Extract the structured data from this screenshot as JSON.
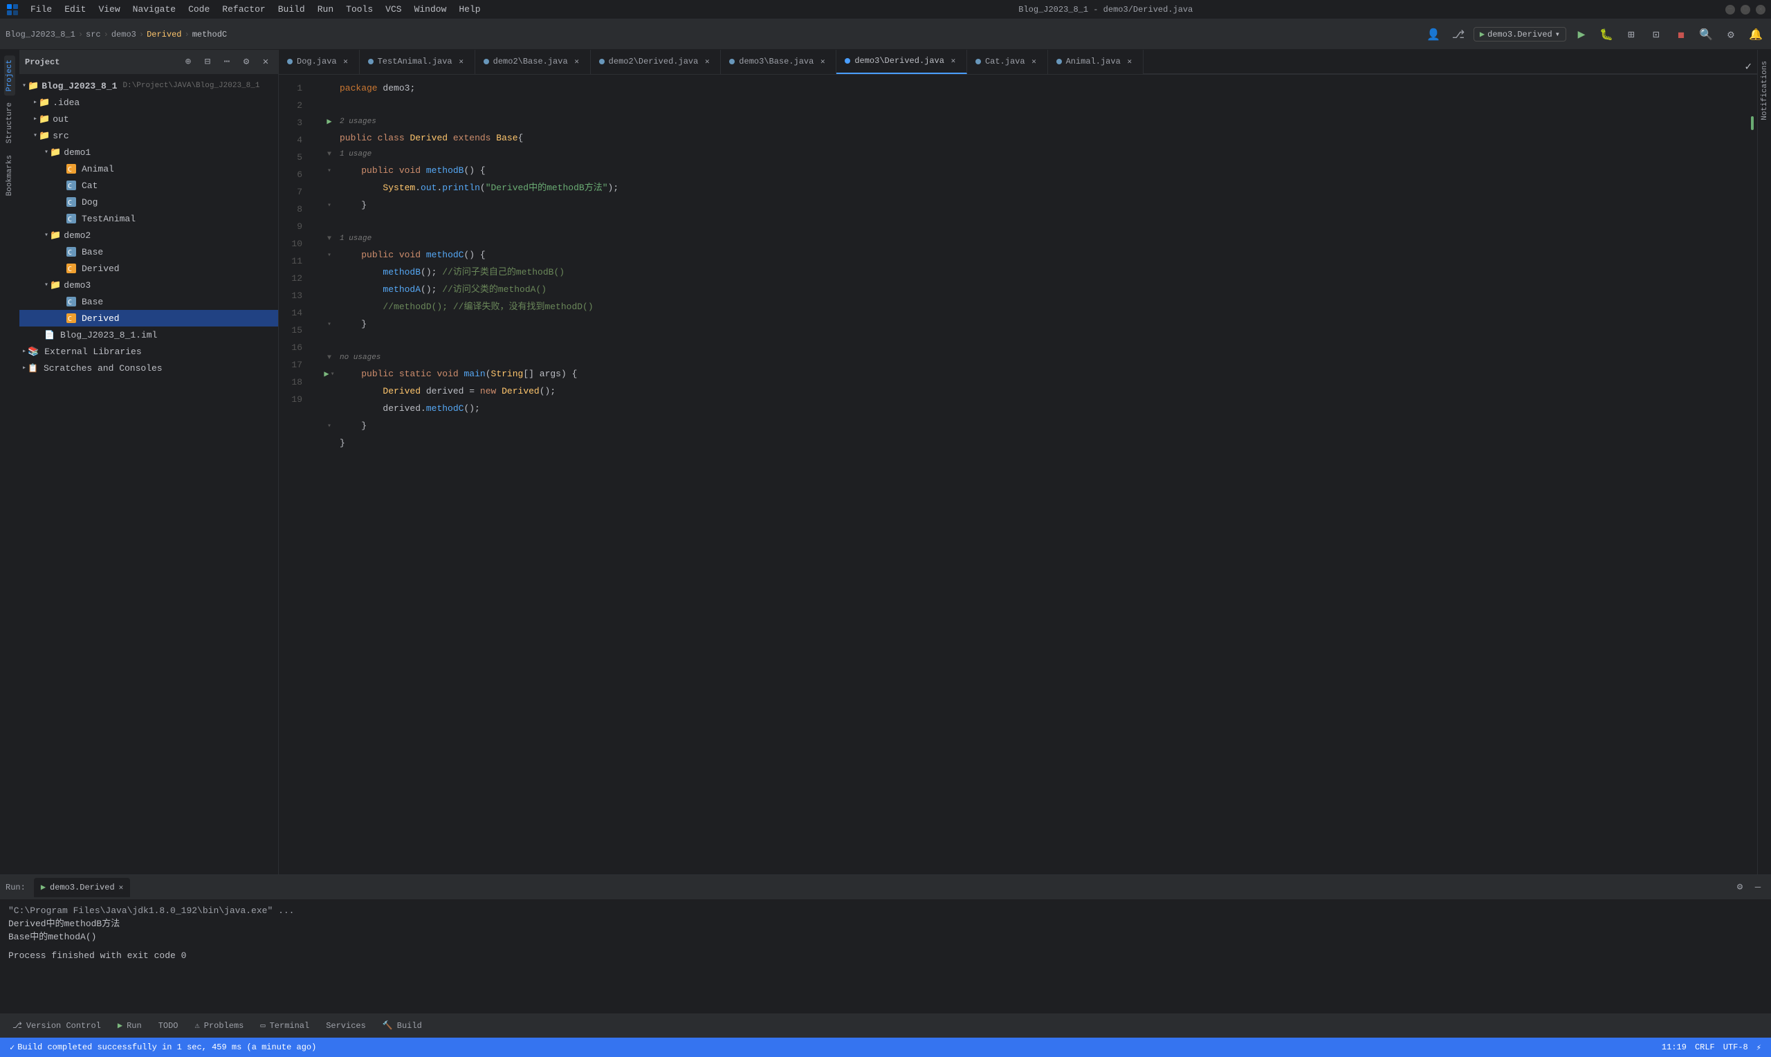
{
  "window": {
    "title": "Blog_J2023_8_1 - demo3/Derived.java"
  },
  "menubar": {
    "items": [
      "File",
      "Edit",
      "View",
      "Navigate",
      "Code",
      "Refactor",
      "Build",
      "Run",
      "Tools",
      "VCS",
      "Window",
      "Help"
    ]
  },
  "breadcrumb": {
    "parts": [
      "Blog_J2023_8_1",
      "src",
      "demo3",
      "Derived",
      "methodC"
    ]
  },
  "run_config": {
    "name": "demo3.Derived",
    "dropdown_icon": "▾"
  },
  "tabs": [
    {
      "label": "Dog.java",
      "color": "blue",
      "active": false
    },
    {
      "label": "TestAnimal.java",
      "color": "blue",
      "active": false
    },
    {
      "label": "demo2\\Base.java",
      "color": "blue",
      "active": false
    },
    {
      "label": "demo2\\Derived.java",
      "color": "blue",
      "active": false
    },
    {
      "label": "demo3\\Base.java",
      "color": "blue",
      "active": false
    },
    {
      "label": "demo3\\Derived.java",
      "color": "active-blue",
      "active": true
    },
    {
      "label": "Cat.java",
      "color": "blue",
      "active": false
    },
    {
      "label": "Animal.java",
      "color": "blue",
      "active": false
    }
  ],
  "project_panel": {
    "title": "Project",
    "root": "Blog_J2023_8_1",
    "root_path": "D:\\Project\\JAVA\\Blog_J2023_8_1",
    "tree": [
      {
        "indent": 0,
        "icon": "folder",
        "label": ".idea",
        "expanded": false
      },
      {
        "indent": 0,
        "icon": "folder",
        "label": "out",
        "expanded": false
      },
      {
        "indent": 0,
        "icon": "folder",
        "label": "src",
        "expanded": true
      },
      {
        "indent": 1,
        "icon": "folder",
        "label": "demo1",
        "expanded": true
      },
      {
        "indent": 2,
        "icon": "class-orange",
        "label": "Animal"
      },
      {
        "indent": 2,
        "icon": "class-blue",
        "label": "Cat"
      },
      {
        "indent": 2,
        "icon": "class-blue",
        "label": "Dog"
      },
      {
        "indent": 2,
        "icon": "class-blue",
        "label": "TestAnimal"
      },
      {
        "indent": 1,
        "icon": "folder",
        "label": "demo2",
        "expanded": true
      },
      {
        "indent": 2,
        "icon": "class-blue",
        "label": "Base"
      },
      {
        "indent": 2,
        "icon": "class-orange",
        "label": "Derived"
      },
      {
        "indent": 1,
        "icon": "folder",
        "label": "demo3",
        "expanded": true
      },
      {
        "indent": 2,
        "icon": "class-blue",
        "label": "Base"
      },
      {
        "indent": 2,
        "icon": "class-orange",
        "label": "Derived",
        "selected": true
      },
      {
        "indent": 0,
        "icon": "file-iml",
        "label": "Blog_J2023_8_1.iml"
      },
      {
        "indent": 0,
        "icon": "folder-ext",
        "label": "External Libraries",
        "expanded": false
      },
      {
        "indent": 0,
        "icon": "scratches",
        "label": "Scratches and Consoles"
      }
    ]
  },
  "code": {
    "filename": "Derived.java",
    "package_line": "package demo3;",
    "lines": [
      {
        "num": 1,
        "content": "package demo3;",
        "type": "package"
      },
      {
        "num": 2,
        "content": "",
        "type": "empty"
      },
      {
        "num": 3,
        "content": "public class Derived extends Base{",
        "type": "class_decl",
        "usage": "2 usages",
        "has_run": true
      },
      {
        "num": 4,
        "content": "    public void methodB() {",
        "type": "method_decl",
        "usage": "1 usage",
        "has_fold": true
      },
      {
        "num": 5,
        "content": "        System.out.println(\"Derived中的methodB方法\");",
        "type": "code"
      },
      {
        "num": 6,
        "content": "    }",
        "type": "code",
        "has_fold": true
      },
      {
        "num": 7,
        "content": "",
        "type": "empty"
      },
      {
        "num": 8,
        "content": "    public void methodC() {",
        "type": "method_decl",
        "usage": "1 usage",
        "has_fold": true
      },
      {
        "num": 9,
        "content": "        methodB(); //访问子类自己的methodB()",
        "type": "code"
      },
      {
        "num": 10,
        "content": "        methodA(); //访问父类的methodA()",
        "type": "code"
      },
      {
        "num": 11,
        "content": "        //methodD(); //编译失败，没有找到methodD()",
        "type": "comment"
      },
      {
        "num": 12,
        "content": "    }",
        "type": "code",
        "has_fold": true
      },
      {
        "num": 13,
        "content": "",
        "type": "empty"
      },
      {
        "num": 14,
        "content": "    public static void main(String[] args) {",
        "type": "method_decl",
        "usage": "no usages",
        "has_run": true,
        "has_fold": true
      },
      {
        "num": 15,
        "content": "        Derived derived = new Derived();",
        "type": "code"
      },
      {
        "num": 16,
        "content": "        derived.methodC();",
        "type": "code"
      },
      {
        "num": 17,
        "content": "    }",
        "type": "code",
        "has_fold": true
      },
      {
        "num": 18,
        "content": "}",
        "type": "code"
      },
      {
        "num": 19,
        "content": "",
        "type": "empty"
      }
    ]
  },
  "bottom_panel": {
    "tabs": [
      {
        "label": "Run",
        "icon": "▶",
        "active": false
      },
      {
        "label": "demo3.Derived",
        "icon": "",
        "active": true
      }
    ],
    "console_lines": [
      {
        "type": "cmd",
        "text": "\"C:\\Program Files\\Java\\jdk1.8.0_192\\bin\\java.exe\" ..."
      },
      {
        "type": "out",
        "text": "Derived中的methodB方法"
      },
      {
        "type": "out",
        "text": "Base中的methodA()"
      },
      {
        "type": "empty",
        "text": ""
      },
      {
        "type": "out",
        "text": "Process finished with exit code 0"
      }
    ]
  },
  "bottom_toolbar_tabs": [
    {
      "label": "Version Control",
      "icon": ""
    },
    {
      "label": "Run",
      "icon": "▶"
    },
    {
      "label": "TODO",
      "icon": ""
    },
    {
      "label": "Problems",
      "icon": ""
    },
    {
      "label": "Terminal",
      "icon": ""
    },
    {
      "label": "Services",
      "icon": ""
    },
    {
      "label": "Build",
      "icon": ""
    }
  ],
  "status_bar": {
    "build_msg": "Build completed successfully in 1 sec, 459 ms (a minute ago)",
    "right_items": [
      "11:19",
      "CRLF",
      "UTF-8",
      "⚡"
    ]
  },
  "vert_tabs_left": [
    "Project",
    "Structure",
    "Bookmarks"
  ],
  "notifications_label": "Notifications"
}
